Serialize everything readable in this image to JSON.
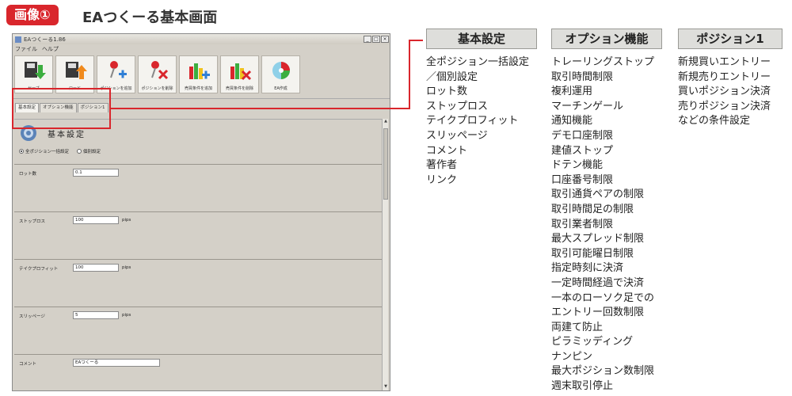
{
  "figure": {
    "badge": "画像①",
    "title": "EAつくーる基本画面"
  },
  "window": {
    "title": "EAつくーる1.86",
    "controls": [
      "_",
      "□",
      "×"
    ],
    "menu": [
      "ファイル",
      "ヘルプ"
    ],
    "toolbar": [
      {
        "label": "セーブ",
        "icon": "save-download-icon"
      },
      {
        "label": "ロード",
        "icon": "load-upload-icon"
      },
      {
        "label": "ポジションを追加",
        "icon": "add-position-pin-icon"
      },
      {
        "label": "ポジションを削除",
        "icon": "delete-position-pin-icon"
      },
      {
        "label": "売買条件を追加",
        "icon": "add-condition-chart-icon"
      },
      {
        "label": "売買条件を削除",
        "icon": "delete-condition-chart-icon"
      },
      {
        "label": "EA作成",
        "icon": "ea-create-disc-icon"
      }
    ],
    "tabs": [
      "基本設定",
      "オプション機能",
      "ポジション1"
    ],
    "active_tab": "基本設定",
    "section_title": "基本設定",
    "radios": [
      {
        "label": "全ポジション一括設定",
        "selected": true
      },
      {
        "label": "個別設定",
        "selected": false
      }
    ],
    "fields": {
      "lot": {
        "label": "ロット数",
        "value": "0.1"
      },
      "stoploss": {
        "label": "ストップロス",
        "value": "100",
        "unit": "pips"
      },
      "takeprofit": {
        "label": "テイクプロフィット",
        "value": "100",
        "unit": "pips"
      },
      "slippage": {
        "label": "スリッページ",
        "value": "5",
        "unit": "pips"
      },
      "comment": {
        "label": "コメント",
        "value": "EAつくーる"
      }
    }
  },
  "columns": {
    "basic": {
      "heading": "基本設定",
      "items": [
        "全ポジション一括設定",
        "／個別設定",
        "ロット数",
        "ストップロス",
        "テイクプロフィット",
        "スリッページ",
        "コメント",
        "著作者",
        "リンク"
      ]
    },
    "options": {
      "heading": "オプション機能",
      "items": [
        "トレーリングストップ",
        "取引時間制限",
        "複利運用",
        "マーチンゲール",
        "通知機能",
        "デモ口座制限",
        "建値ストップ",
        "ドテン機能",
        "口座番号制限",
        "取引通貨ペアの制限",
        "取引時間足の制限",
        "取引業者制限",
        "最大スプレッド制限",
        "取引可能曜日制限",
        "指定時刻に決済",
        "一定時間経過で決済",
        "一本のローソク足での",
        "エントリー回数制限",
        "両建て防止",
        "ピラミッディング",
        "ナンピン",
        "最大ポジション数制限",
        "週末取引停止"
      ]
    },
    "position": {
      "heading": "ポジション1",
      "items": [
        "新規買いエントリー",
        "新規売りエントリー",
        "買いポジション決済",
        "売りポジション決済",
        "などの条件設定"
      ]
    }
  },
  "colors": {
    "accent": "#d9262c",
    "window_bg": "#d4d0c8",
    "header_bg": "#dededb"
  }
}
